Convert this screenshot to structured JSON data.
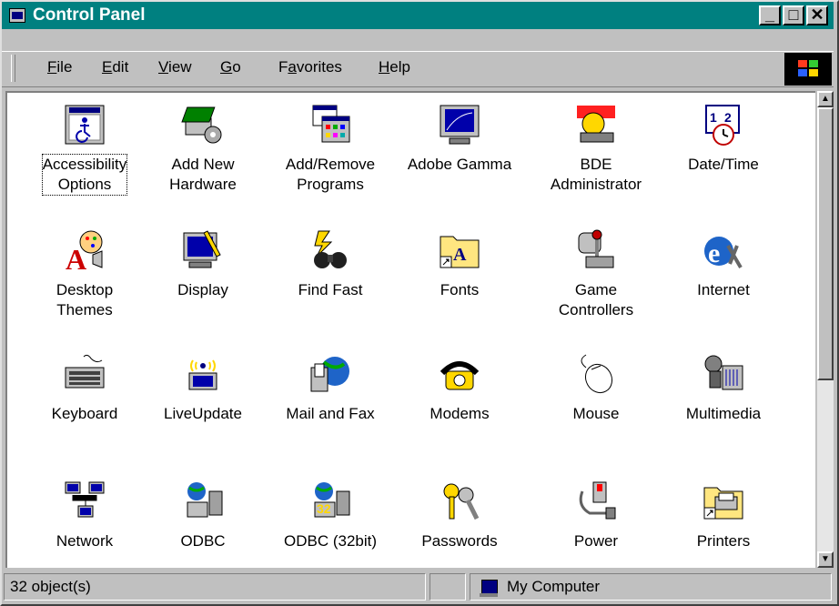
{
  "window": {
    "title": "Control Panel",
    "buttons": {
      "minimize": "_",
      "maximize": "□",
      "close": "✕"
    }
  },
  "menubar": {
    "items": [
      {
        "label": "File",
        "accel": "F",
        "rest": "ile"
      },
      {
        "label": "Edit",
        "accel": "E",
        "rest": "dit"
      },
      {
        "label": "View",
        "accel": "V",
        "rest": "iew"
      },
      {
        "label": "Go",
        "accel": "G",
        "rest": "o"
      },
      {
        "label": "Favorites",
        "accel": "a",
        "pre": "F",
        "rest": "vorites"
      },
      {
        "label": "Help",
        "accel": "H",
        "rest": "elp"
      }
    ]
  },
  "items": [
    {
      "label": "Accessibility\nOptions",
      "icon": "accessibility-icon",
      "selected": true
    },
    {
      "label": "Add New\nHardware",
      "icon": "hardware-icon"
    },
    {
      "label": "Add/Remove\nPrograms",
      "icon": "programs-icon"
    },
    {
      "label": "Adobe Gamma",
      "icon": "monitor-gamma-icon"
    },
    {
      "label": "BDE\nAdministrator",
      "icon": "bde-icon"
    },
    {
      "label": "Date/Time",
      "icon": "calendar-clock-icon"
    },
    {
      "label": "Desktop\nThemes",
      "icon": "themes-icon"
    },
    {
      "label": "Display",
      "icon": "display-icon"
    },
    {
      "label": "Find Fast",
      "icon": "binoculars-icon"
    },
    {
      "label": "Fonts",
      "icon": "fonts-folder-icon"
    },
    {
      "label": "Game\nControllers",
      "icon": "joystick-icon"
    },
    {
      "label": "Internet",
      "icon": "internet-explorer-icon"
    },
    {
      "label": "Keyboard",
      "icon": "keyboard-icon"
    },
    {
      "label": "LiveUpdate",
      "icon": "liveupdate-icon"
    },
    {
      "label": "Mail and Fax",
      "icon": "mail-fax-icon"
    },
    {
      "label": "Modems",
      "icon": "modem-phone-icon"
    },
    {
      "label": "Mouse",
      "icon": "mouse-icon"
    },
    {
      "label": "Multimedia",
      "icon": "multimedia-icon"
    },
    {
      "label": "Network",
      "icon": "network-icon"
    },
    {
      "label": "ODBC",
      "icon": "odbc-icon"
    },
    {
      "label": "ODBC (32bit)",
      "icon": "odbc32-icon"
    },
    {
      "label": "Passwords",
      "icon": "keys-icon"
    },
    {
      "label": "Power",
      "icon": "power-plug-icon"
    },
    {
      "label": "Printers",
      "icon": "printer-folder-icon"
    }
  ],
  "statusbar": {
    "count": "32 object(s)",
    "location": "My Computer"
  }
}
